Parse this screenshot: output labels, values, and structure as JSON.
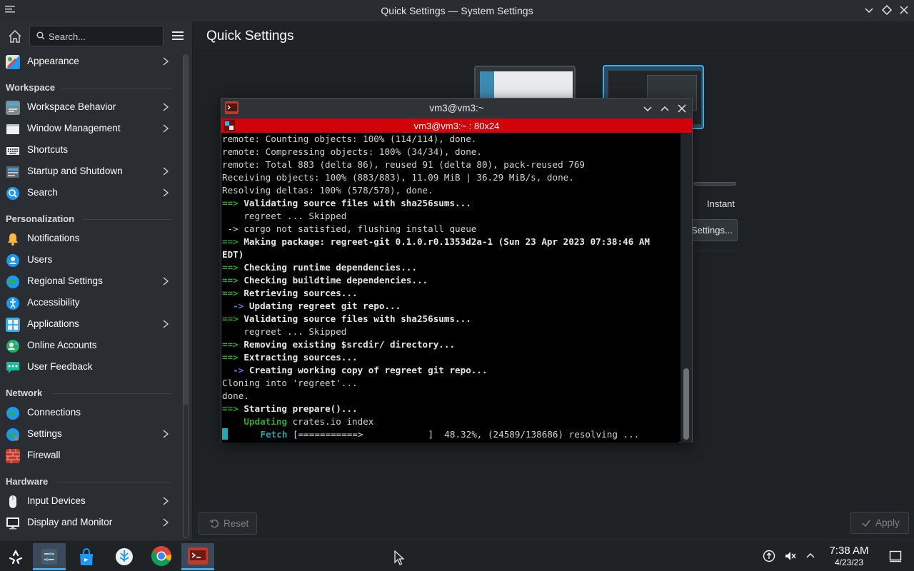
{
  "window": {
    "title": "Quick Settings — System Settings",
    "icons": [
      "menu-icon",
      "minimize-icon",
      "restore-icon",
      "close-icon"
    ]
  },
  "sidebar": {
    "search_placeholder": "Search...",
    "sections": {
      "workspace": "Workspace",
      "personalization": "Personalization",
      "network": "Network",
      "hardware": "Hardware"
    },
    "items": [
      {
        "label": "Appearance",
        "icon": "appearance-icon",
        "arrow": true
      },
      {
        "label": "Workspace Behavior",
        "icon": "workspace-behavior-icon",
        "arrow": true
      },
      {
        "label": "Window Management",
        "icon": "window-management-icon",
        "arrow": true
      },
      {
        "label": "Shortcuts",
        "icon": "keyboard-icon",
        "arrow": false
      },
      {
        "label": "Startup and Shutdown",
        "icon": "startup-icon",
        "arrow": true
      },
      {
        "label": "Search",
        "icon": "search-icon",
        "arrow": true
      },
      {
        "label": "Notifications",
        "icon": "bell-icon",
        "arrow": false
      },
      {
        "label": "Users",
        "icon": "users-icon",
        "arrow": false
      },
      {
        "label": "Regional Settings",
        "icon": "regional-icon",
        "arrow": true
      },
      {
        "label": "Accessibility",
        "icon": "accessibility-icon",
        "arrow": false
      },
      {
        "label": "Applications",
        "icon": "applications-icon",
        "arrow": true
      },
      {
        "label": "Online Accounts",
        "icon": "online-accounts-icon",
        "arrow": false
      },
      {
        "label": "User Feedback",
        "icon": "feedback-icon",
        "arrow": false
      },
      {
        "label": "Connections",
        "icon": "globe-icon",
        "arrow": false
      },
      {
        "label": "Settings",
        "icon": "network-settings-icon",
        "arrow": true
      },
      {
        "label": "Firewall",
        "icon": "firewall-icon",
        "arrow": false
      },
      {
        "label": "Input Devices",
        "icon": "mouse-icon",
        "arrow": true
      },
      {
        "label": "Display and Monitor",
        "icon": "monitor-icon",
        "arrow": true
      }
    ]
  },
  "main": {
    "page_title": "Quick Settings",
    "animation_speed_label": "Instant",
    "more_settings_label": "Settings...",
    "reset_label": "Reset",
    "apply_label": "Apply"
  },
  "terminal": {
    "title": "vm3@vm3:~",
    "tab_title": "vm3@vm3:~ : 80x24",
    "lines": [
      {
        "plain": "remote: Counting objects: 100% (114/114), done."
      },
      {
        "plain": "remote: Compressing objects: 100% (34/34), done."
      },
      {
        "plain": "remote: Total 883 (delta 86), reused 91 (delta 80), pack-reused 769"
      },
      {
        "plain": "Receiving objects: 100% (883/883), 11.09 MiB | 36.29 MiB/s, done."
      },
      {
        "plain": "Resolving deltas: 100% (578/578), done."
      },
      {
        "prefix": "==>",
        "bold": " Validating source files with sha256sums..."
      },
      {
        "plain": "    regreet ... Skipped"
      },
      {
        "plain": " -> cargo not satisfied, flushing install queue"
      },
      {
        "prefix": "==>",
        "bold": " Making package: regreet-git 0.1.0.r0.1353d2a-1 (Sun 23 Apr 2023 07:38:46 AM"
      },
      {
        "bold_only": "EDT)"
      },
      {
        "prefix": "==>",
        "bold": " Checking runtime dependencies..."
      },
      {
        "prefix": "==>",
        "bold": " Checking buildtime dependencies..."
      },
      {
        "prefix": "==>",
        "bold": " Retrieving sources..."
      },
      {
        "prefix2": "  ->",
        "bold": " Updating regreet git repo..."
      },
      {
        "prefix": "==>",
        "bold": " Validating source files with sha256sums..."
      },
      {
        "plain": "    regreet ... Skipped"
      },
      {
        "prefix": "==>",
        "bold": " Removing existing $srcdir/ directory..."
      },
      {
        "prefix": "==>",
        "bold": " Extracting sources..."
      },
      {
        "prefix2": "  ->",
        "bold": " Creating working copy of regreet git repo..."
      },
      {
        "plain": "Cloning into 'regreet'..."
      },
      {
        "plain": "done."
      },
      {
        "prefix": "==>",
        "bold": " Starting prepare()..."
      },
      {
        "green": "    Updating",
        "plain": " crates.io index"
      },
      {
        "cursor": true,
        "cyan": "      Fetch",
        "plain": " [===========>            ]  48.32%, (24589/138686) resolving ..."
      }
    ]
  },
  "taskbar": {
    "apps": [
      "application-launcher-icon",
      "system-settings-icon",
      "discover-icon",
      "kde-icon",
      "chrome-icon",
      "konsole-icon"
    ],
    "tray": [
      "update-icon",
      "volume-muted-icon",
      "expand-tray-icon",
      "show-desktop-icon"
    ],
    "time": "7:38 AM",
    "date": "4/23/23"
  },
  "colors": {
    "accent": "#3daee9",
    "terminal_tab": "#d0020a",
    "prompt_green": "#2ea32e",
    "arrow_blue": "#4a86e8"
  }
}
